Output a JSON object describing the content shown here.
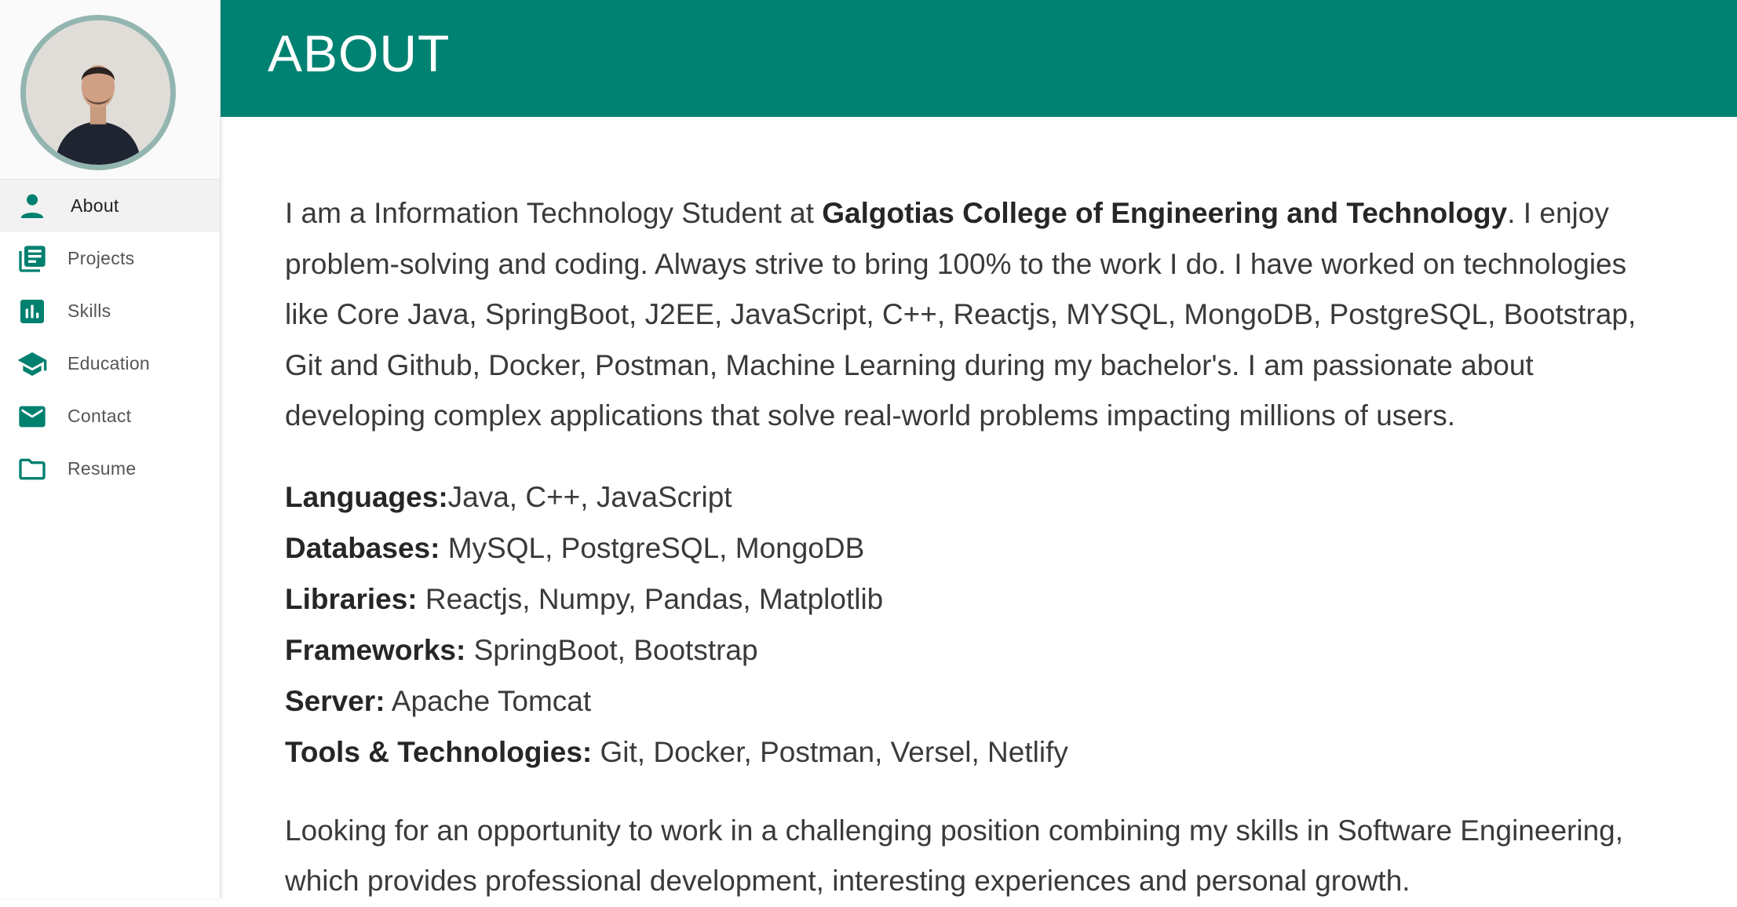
{
  "sidebar": {
    "items": [
      {
        "label": "About",
        "icon": "person-icon",
        "active": true
      },
      {
        "label": "Projects",
        "icon": "library-books-icon",
        "active": false
      },
      {
        "label": "Skills",
        "icon": "bar-chart-icon",
        "active": false
      },
      {
        "label": "Education",
        "icon": "graduation-cap-icon",
        "active": false
      },
      {
        "label": "Contact",
        "icon": "mail-icon",
        "active": false
      },
      {
        "label": "Resume",
        "icon": "folder-icon",
        "active": false
      }
    ]
  },
  "header": {
    "title": "ABOUT"
  },
  "about": {
    "intro_prefix": "I am a Information Technology Student at ",
    "college": "Galgotias College of Engineering and Technology",
    "intro_suffix": ". I enjoy problem-solving and coding. Always strive to bring 100% to the work I do. I have worked on technologies like Core Java, SpringBoot, J2EE, JavaScript, C++, Reactjs, MYSQL, MongoDB, PostgreSQL, Bootstrap, Git and Github, Docker, Postman, Machine Learning during my bachelor's. I am passionate about developing complex applications that solve real-world problems impacting millions of users.",
    "skills": [
      {
        "key": "Languages:",
        "value": "Java, C++, JavaScript"
      },
      {
        "key": "Databases:",
        "value": " MySQL, PostgreSQL, MongoDB"
      },
      {
        "key": "Libraries:",
        "value": " Reactjs, Numpy, Pandas, Matplotlib"
      },
      {
        "key": "Frameworks:",
        "value": " SpringBoot, Bootstrap"
      },
      {
        "key": "Server:",
        "value": " Apache Tomcat"
      },
      {
        "key": "Tools & Technologies:",
        "value": " Git, Docker, Postman, Versel, Netlify"
      }
    ],
    "closing": "Looking for an opportunity to work in a challenging position combining my skills in Software Engineering, which provides professional development, interesting experiences and personal growth."
  },
  "colors": {
    "accent": "#008272",
    "avatar_ring": "#93b5af"
  }
}
